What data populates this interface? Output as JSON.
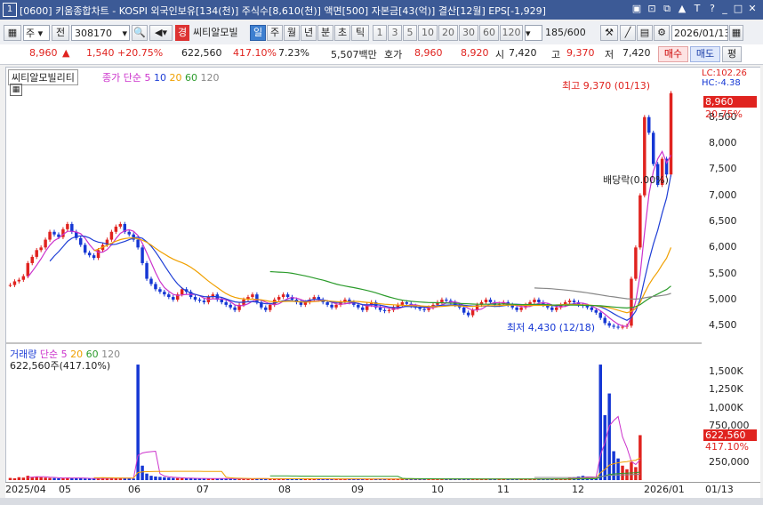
{
  "window": {
    "index": "1",
    "title": "[0600] 키움종합차트 - KOSPI 외국인보유[134(천)] 주식수[8,610(천)] 액면[500] 자본금[43(억)] 결산[12월] EPS[-1,929]",
    "buttons": [
      "▣",
      "⊡",
      "⧉",
      "▲",
      "T",
      "?",
      "_",
      "□",
      "✕"
    ]
  },
  "toolbar": {
    "stock_type": "주",
    "prev_label": "전",
    "code": "308170",
    "search_icon": "search-icon",
    "sound_icon": "speaker-icon",
    "badge": "경",
    "stock_name": "씨티알모빌",
    "periods": [
      "일",
      "주",
      "월",
      "년",
      "분",
      "초",
      "틱"
    ],
    "selected_period": "일",
    "intervals": [
      "1",
      "3",
      "5",
      "10",
      "20",
      "30",
      "60",
      "120"
    ],
    "count": "185",
    "count_total": "/600",
    "date": "2026/01/13"
  },
  "quote": {
    "price": "8,960",
    "arrow": "▲",
    "change": "1,540",
    "change_pct": "+20.75%",
    "volume": "622,560",
    "volume_ratio": "417.10%",
    "turnover": "7.23%",
    "amount": "5,507백만",
    "ask_label": "호가",
    "ask": "8,960",
    "bid": "8,920",
    "open_label": "시",
    "open": "7,420",
    "high_label": "고",
    "high": "9,370",
    "low_label": "저",
    "low": "7,420",
    "buy_label": "매수",
    "sell_label": "매도",
    "eval_label": "평"
  },
  "chart_data": {
    "type": "candlestick",
    "legend": {
      "name": "씨티알모빌리티",
      "ma_label": "종가 단순",
      "ma_periods": [
        "5",
        "10",
        "20",
        "60",
        "120"
      ],
      "ma_colors": [
        "#cc33cc",
        "#1f3fd6",
        "#f0a000",
        "#2b9b2b",
        "#888888"
      ]
    },
    "price_axis": {
      "ticks": [
        "8,500",
        "8,000",
        "7,500",
        "7,000",
        "6,500",
        "6,000",
        "5,500",
        "5,000",
        "4,500"
      ],
      "range": [
        4250,
        9450
      ]
    },
    "lc": "LC:102.26",
    "hc": "HC:-4.38",
    "current_price": "8,960",
    "current_pct": "20.75%",
    "high_annotation": "최고 9,370 (01/13)",
    "low_annotation": "최저 4,430 (12/18)",
    "dividend_annotation": "배당락(0.00%)",
    "volume_legend": {
      "label": "거래량",
      "ma_label": "단순",
      "ma_periods": [
        "5",
        "20",
        "60",
        "120"
      ],
      "value": "622,560주(417.10%)"
    },
    "volume_axis": {
      "ticks": [
        "1,500K",
        "1,250K",
        "1,000K",
        "750,000",
        "250,000"
      ],
      "range": [
        0,
        1650000
      ]
    },
    "current_volume": "622,560",
    "current_volume_pct": "417.10%",
    "x_labels": [
      "2025/04",
      "05",
      "06",
      "07",
      "08",
      "09",
      "10",
      "11",
      "12",
      "2026/01",
      "01/13"
    ],
    "series": [
      {
        "name": "price",
        "values": [
          5280,
          5350,
          5380,
          5450,
          5700,
          5820,
          5950,
          6000,
          6150,
          6300,
          6250,
          6200,
          6350,
          6450,
          6300,
          6180,
          6050,
          5900,
          5850,
          5800,
          5950,
          6050,
          6150,
          6300,
          6400,
          6450,
          6300,
          6250,
          6150,
          6000,
          5700,
          5400,
          5300,
          5200,
          5150,
          5100,
          5050,
          5000,
          5100,
          5200,
          5150,
          5050,
          5000,
          4980,
          4950,
          5050,
          5100,
          5000,
          4950,
          4900,
          4850,
          4800,
          4900,
          5000,
          5050,
          5100,
          4950,
          4850,
          4800,
          4900,
          5000,
          5050,
          5100,
          5050,
          5000,
          4950,
          4900,
          4950,
          5000,
          5050,
          5000,
          4950,
          4900,
          4850,
          4900,
          4950,
          5000,
          4950,
          4900,
          4850,
          4800,
          4900,
          4950,
          4850,
          4800,
          4780,
          4800,
          4850,
          4900,
          4950,
          4920,
          4880,
          4850,
          4820,
          4800,
          4850,
          4900,
          4950,
          5000,
          4980,
          4950,
          4900,
          4850,
          4750,
          4700,
          4800,
          4900,
          4950,
          5000,
          4950,
          4900,
          4920,
          4950,
          4900,
          4850,
          4800,
          4850,
          4900,
          4950,
          5000,
          4950,
          4900,
          4850,
          4800,
          4850,
          4900,
          4950,
          4980,
          4950,
          4900,
          4880,
          4850,
          4800,
          4750,
          4650,
          4550,
          4500,
          4480,
          4470,
          4480,
          4500,
          5400,
          6000,
          7000,
          8500,
          8200,
          7600,
          7200,
          7700,
          7400,
          8960
        ]
      },
      {
        "name": "volume",
        "values": [
          30000,
          25000,
          40000,
          35000,
          60000,
          45000,
          50000,
          40000,
          35000,
          30000,
          28000,
          25000,
          30000,
          35000,
          30000,
          28000,
          25000,
          22000,
          20000,
          22000,
          25000,
          30000,
          28000,
          25000,
          26000,
          30000,
          28000,
          25000,
          22000,
          1600000,
          200000,
          90000,
          60000,
          50000,
          45000,
          40000,
          35000,
          30000,
          28000,
          26000,
          25000,
          24000,
          22000,
          22000,
          21000,
          20000,
          21000,
          22000,
          20000,
          19000,
          18000,
          17000,
          18000,
          19000,
          20000,
          21000,
          20000,
          19000,
          18000,
          17000,
          16000,
          17000,
          18000,
          19000,
          20000,
          19000,
          18000,
          17000,
          16000,
          15000,
          16000,
          17000,
          16000,
          15000,
          16000,
          17000,
          18000,
          17000,
          16000,
          15000,
          14000,
          15000,
          16000,
          15000,
          14000,
          13000,
          14000,
          15000,
          16000,
          17000,
          16000,
          15000,
          14000,
          13000,
          14000,
          15000,
          16000,
          17000,
          18000,
          17000,
          16000,
          15000,
          14000,
          13000,
          14000,
          15000,
          16000,
          17000,
          16000,
          15000,
          14000,
          15000,
          16000,
          17000,
          16000,
          15000,
          14000,
          15000,
          16000,
          17000,
          18000,
          17000,
          16000,
          15000,
          16000,
          17000,
          18000,
          30000,
          40000,
          50000,
          60000,
          40000,
          30000,
          25000,
          1600000,
          900000,
          1200000,
          400000,
          300000,
          200000,
          150000,
          250000,
          180000,
          622560
        ]
      }
    ]
  }
}
